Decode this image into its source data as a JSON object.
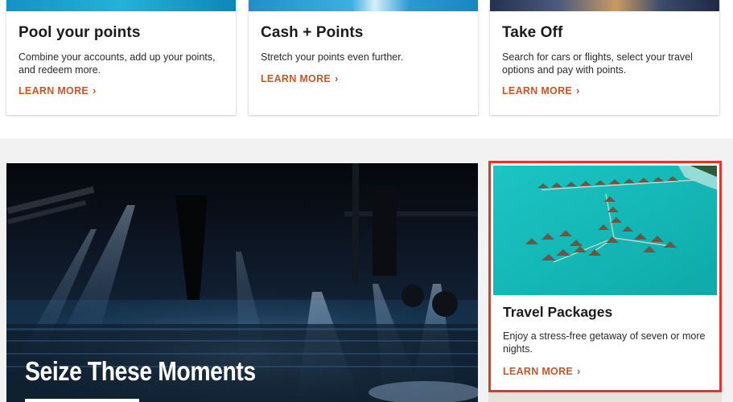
{
  "cards": [
    {
      "title": "Pool your points",
      "description": "Combine your accounts, add up your points, and redeem more.",
      "link": "LEARN MORE"
    },
    {
      "title": "Cash + Points",
      "description": "Stretch your points even further.",
      "link": "LEARN MORE"
    },
    {
      "title": "Take Off",
      "description": "Search for cars or flights, select your travel options and pay with points.",
      "link": "LEARN MORE"
    }
  ],
  "feature": {
    "title": "Seize These Moments"
  },
  "travel": {
    "title": "Travel Packages",
    "description": "Enjoy a stress-free getaway of seven or more nights.",
    "link": "LEARN MORE"
  },
  "icons": {
    "chevron": "chevron-right-icon"
  },
  "colors": {
    "accent": "#c4572a",
    "highlight_border": "#e3352a",
    "section_bg": "#f2f2f2"
  }
}
